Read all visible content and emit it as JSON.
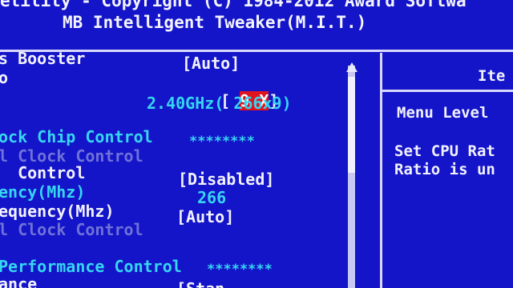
{
  "header": {
    "copyright": "etility - Copyright (C) 1984-2012 Award Softwa",
    "subtitle": "MB Intelligent Tweaker(M.I.T.)"
  },
  "settings": {
    "booster_label": "s Booster",
    "booster_value": "[Auto]",
    "ratio_label": "o",
    "ratio_value_open": "[ ",
    "ratio_value_sel": "9 X",
    "ratio_value_close": "]",
    "freq_readout": "2.40GHz( 266x9)",
    "clock_chip_label": "ock Chip Control",
    "clock_chip_stars": "********",
    "grayed1": "l Clock Control",
    "control_label": "  Control",
    "control_value": "[Disabled]",
    "freq_mhz_label": "ency(Mhz)",
    "freq_mhz_value": "266",
    "freq2_label": "equency(Mhz)",
    "freq2_value": "[Auto]",
    "grayed2": "l Clock Control",
    "perf_label": "Performance Control",
    "perf_stars": "********",
    "last_label": "ance",
    "last_value": "[Stan"
  },
  "help": {
    "title": "Ite",
    "menu_level": "Menu Level",
    "line1": "Set CPU Rat",
    "line2": "Ratio is un"
  }
}
